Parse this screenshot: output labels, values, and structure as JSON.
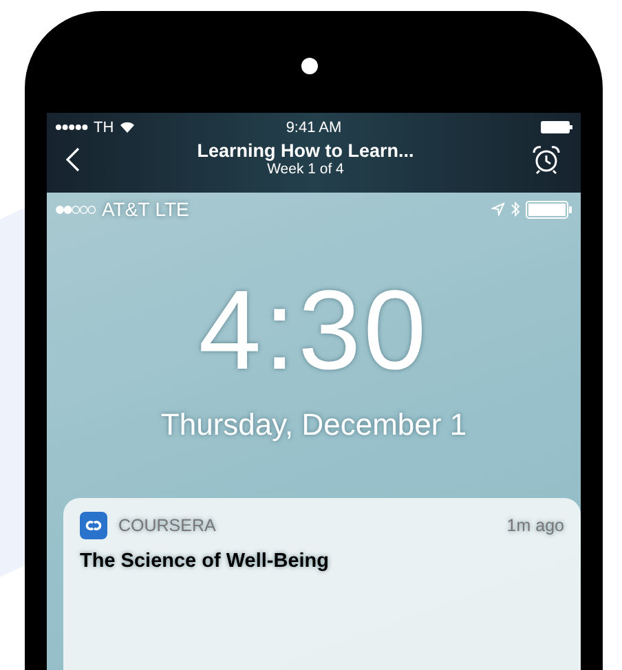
{
  "app_status_bar": {
    "carrier": "TH",
    "time": "9:41 AM"
  },
  "nav_bar": {
    "title": "Learning How to Learn...",
    "subtitle": "Week 1 of 4"
  },
  "lock_screen": {
    "carrier": "AT&T",
    "network": "LTE",
    "time": "4:30",
    "date": "Thursday, December 1"
  },
  "notification": {
    "app": "COURSERA",
    "age": "1m ago",
    "title": "The Science of Well-Being"
  }
}
